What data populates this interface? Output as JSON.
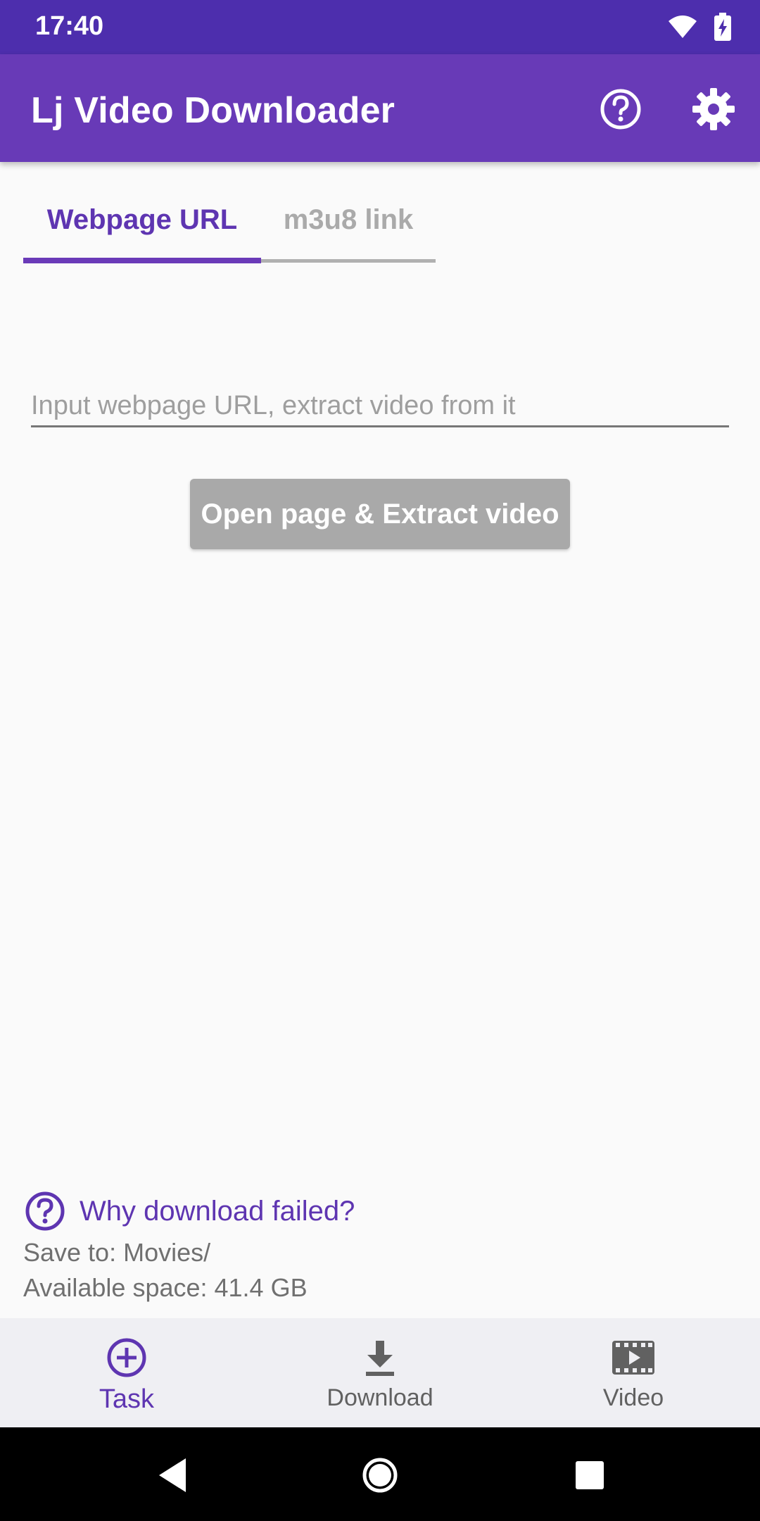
{
  "status_bar": {
    "time": "17:40",
    "icons": [
      "wifi-icon",
      "battery-charging-icon"
    ]
  },
  "app_bar": {
    "title": "Lj Video Downloader",
    "actions": [
      "help-icon",
      "settings-icon"
    ]
  },
  "tabs": [
    {
      "label": "Webpage URL",
      "selected": true
    },
    {
      "label": "m3u8 link",
      "selected": false
    }
  ],
  "url_input": {
    "value": "",
    "placeholder": "Input webpage URL, extract video from it"
  },
  "extract_button": {
    "label": "Open page & Extract video"
  },
  "footer_info": {
    "help_link": "Why download failed?",
    "save_to": "Save to: Movies/",
    "available_space": "Available space: 41.4 GB"
  },
  "bottom_nav": [
    {
      "label": "Task",
      "icon": "add-circle-icon",
      "selected": true
    },
    {
      "label": "Download",
      "icon": "download-icon",
      "selected": false
    },
    {
      "label": "Video",
      "icon": "film-icon",
      "selected": false
    }
  ],
  "colors": {
    "primary": "#683ab7",
    "primary_dark": "#4d2ead",
    "accent": "#5e35b1",
    "button_disabled": "#a9a9a9",
    "background": "#fafafa"
  }
}
